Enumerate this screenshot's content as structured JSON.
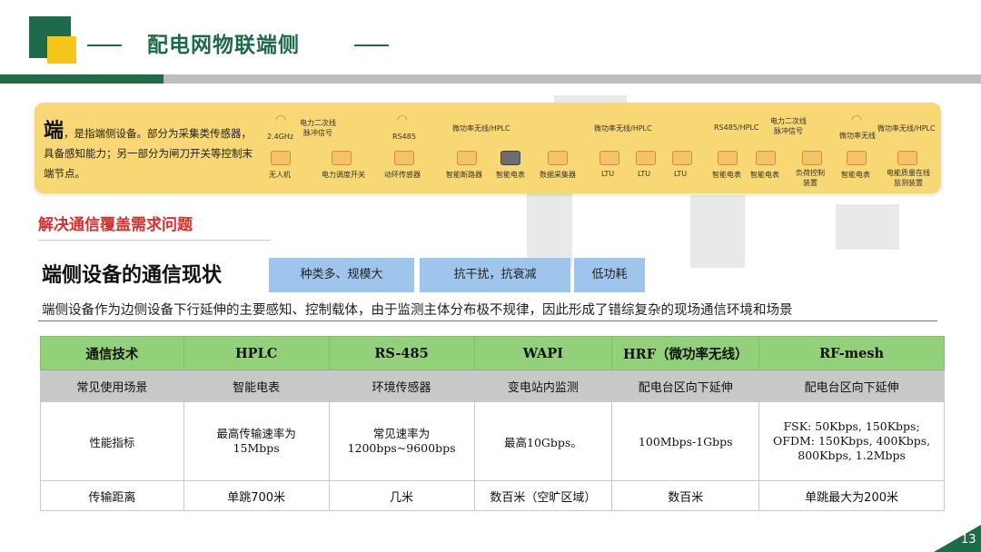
{
  "header": {
    "title": "配电网物联端侧"
  },
  "panel": {
    "lead_char": "端",
    "intro": "，是指端侧设备。部分为采集类传感器，具备感知能力；另一部分为闸刀开关等控制末端节点。",
    "groups": [
      {
        "top_label": "2.4GHz",
        "bottom_label": "无人机"
      },
      {
        "top_label": "电力二次线\n脉冲信号",
        "bottom_label": "电力调度开关"
      },
      {
        "top_label": "RS485",
        "bottom_label": "动环传感器"
      },
      {
        "top_label": "微功率无线/HPLC",
        "bottom_labels": [
          "智能断路器",
          "智能电表",
          "数据采集器"
        ]
      },
      {
        "top_label": "微功率无线/HPLC",
        "bottom_labels": [
          "LTU",
          "LTU",
          "LTU"
        ]
      },
      {
        "top_label": "RS485/HPLC",
        "bottom_labels": [
          "智能电表",
          "智能电表"
        ]
      },
      {
        "top_label": "电力二次线\n脉冲信号",
        "bottom_label": "负荷控制\n装置"
      },
      {
        "top_label": "微功率无线",
        "bottom_label": "智能电表"
      },
      {
        "top_label": "微功率无线/HPLC",
        "bottom_label": "电能质量在线\n监测装置"
      }
    ]
  },
  "section": {
    "red_heading": "解决通信覆盖需求问题",
    "big_heading": "端侧设备的通信现状",
    "tags": [
      "种类多、规模大",
      "抗干扰，抗衰减",
      "低功耗"
    ],
    "description": "端侧设备作为边侧设备下行延伸的主要感知、控制载体，由于监测主体分布极不规律，因此形成了错综复杂的现场通信环境和场景"
  },
  "table": {
    "header": [
      "通信技术",
      "HPLC",
      "RS-485",
      "WAPI",
      "HRF（微功率无线）",
      "RF-mesh"
    ],
    "row_scene": [
      "常见使用场景",
      "智能电表",
      "环境传感器",
      "变电站内监测",
      "配电台区向下延伸",
      "配电台区向下延伸"
    ],
    "row_perf": {
      "label": "性能指标",
      "hplc": [
        "最高传输速率为",
        "15Mbps"
      ],
      "rs485": [
        "常见速率为",
        "1200bps~9600bps"
      ],
      "wapi": "最高10Gbps。",
      "hrf": "100Mbps-1Gbps",
      "rfmesh": [
        "FSK: 50Kbps, 150Kbps;",
        "OFDM: 150Kbps, 400Kbps,",
        "800Kbps, 1.2Mbps"
      ]
    },
    "row_dist": [
      "传输距离",
      "单跳700米",
      "几米",
      "数百米（空旷区域）",
      "数百米",
      "单跳最大为200米"
    ]
  },
  "page_number": "13"
}
